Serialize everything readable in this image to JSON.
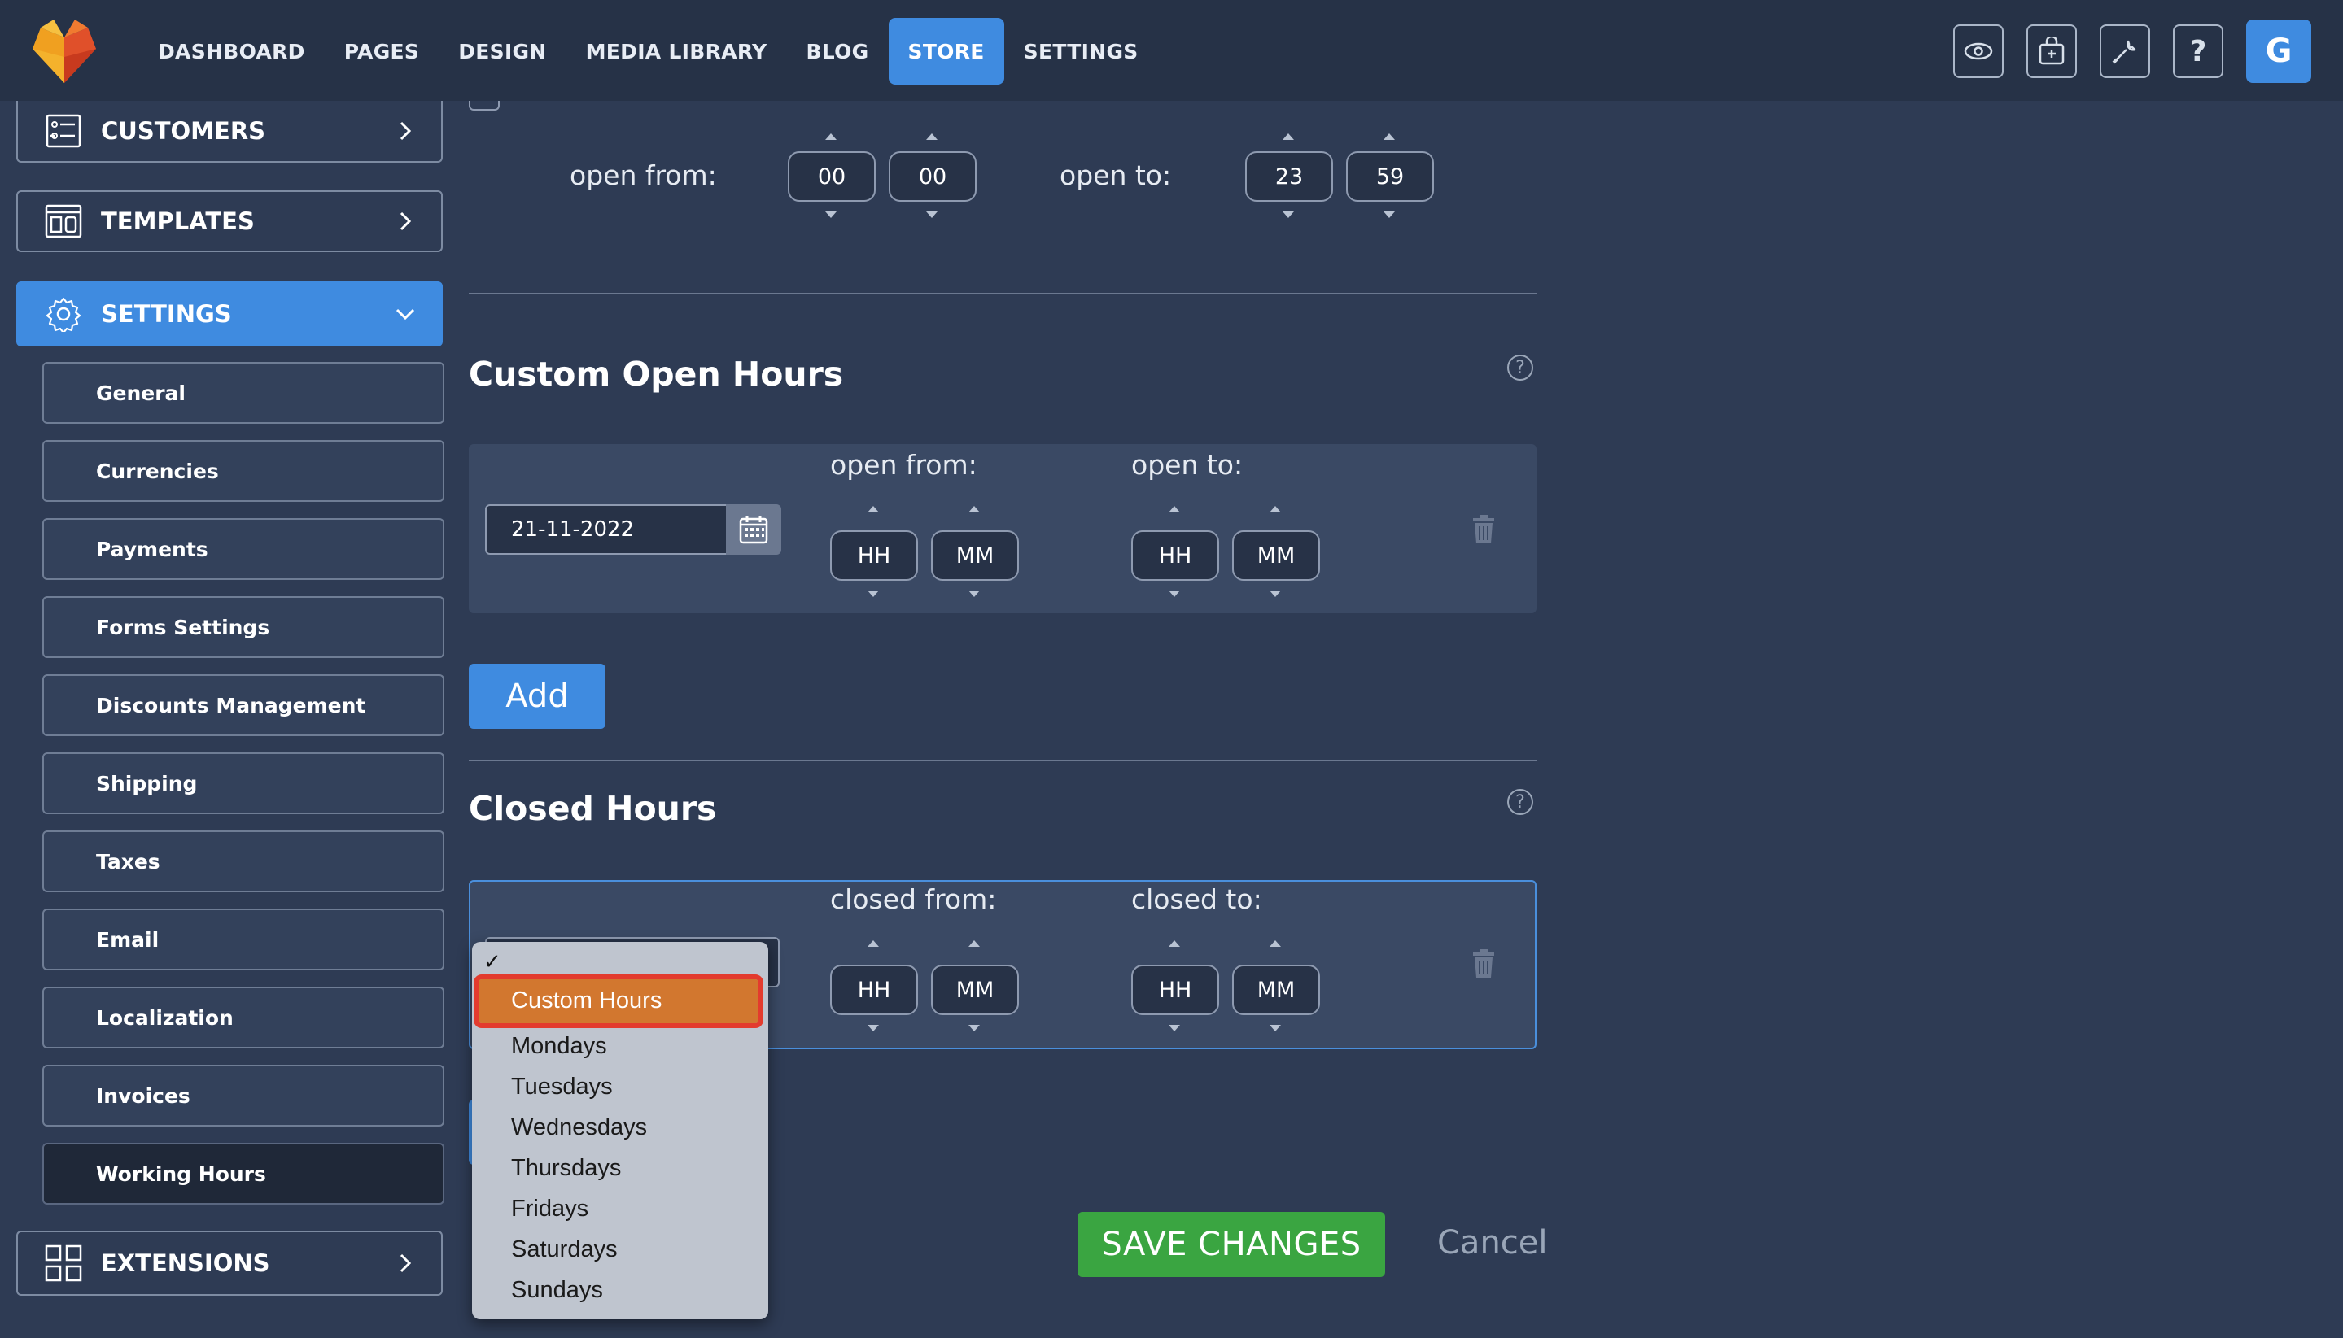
{
  "nav": {
    "items": [
      "DASHBOARD",
      "PAGES",
      "DESIGN",
      "MEDIA LIBRARY",
      "BLOG",
      "STORE",
      "SETTINGS"
    ],
    "active": "STORE",
    "avatar_letter": "G"
  },
  "sidebar": {
    "customers": "CUSTOMERS",
    "templates": "TEMPLATES",
    "settings": "SETTINGS",
    "sub_items": [
      "General",
      "Currencies",
      "Payments",
      "Forms Settings",
      "Discounts Management",
      "Shipping",
      "Taxes",
      "Email",
      "Localization",
      "Invoices",
      "Working Hours"
    ],
    "active_sub": "Working Hours",
    "extensions": "EXTENSIONS"
  },
  "weekly": {
    "open_from_label": "open from:",
    "open_to_label": "open to:",
    "from_hh": "00",
    "from_mm": "00",
    "to_hh": "23",
    "to_mm": "59"
  },
  "custom_open": {
    "title": "Custom Open Hours",
    "date": "21-11-2022",
    "open_from_label": "open from:",
    "open_to_label": "open to:",
    "hh_placeholder": "HH",
    "mm_placeholder": "MM",
    "add_label": "Add"
  },
  "closed": {
    "title": "Closed Hours",
    "closed_from_label": "closed from:",
    "closed_to_label": "closed to:",
    "hh_placeholder": "HH",
    "mm_placeholder": "MM",
    "dropdown_options": [
      "Custom Hours",
      "Mondays",
      "Tuesdays",
      "Wednesdays",
      "Thursdays",
      "Fridays",
      "Saturdays",
      "Sundays"
    ],
    "highlighted_option": "Custom Hours"
  },
  "footer": {
    "save_label": "SAVE CHANGES",
    "cancel_label": "Cancel"
  }
}
